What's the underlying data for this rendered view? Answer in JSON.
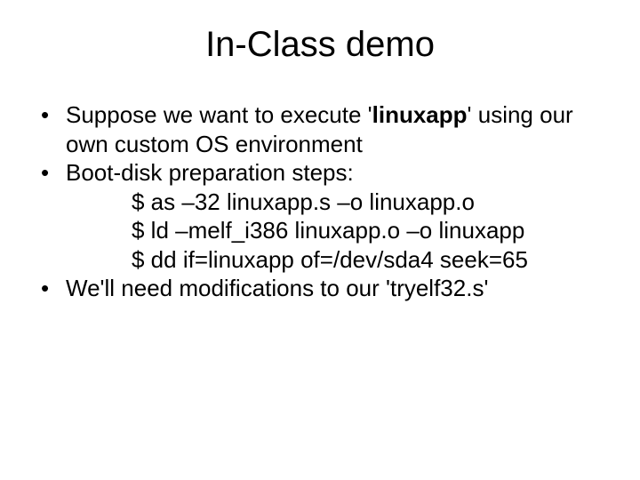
{
  "title": "In-Class demo",
  "bullets": {
    "b1_pre": "Suppose we want to execute '",
    "b1_bold": "linuxapp",
    "b1_post": "' using our own custom OS environment",
    "b2": "Boot-disk preparation steps:",
    "cmds": {
      "c1": "$ as –32 linuxapp.s –o linuxapp.o",
      "c2": "$ ld –melf_i386 linuxapp.o –o linuxapp",
      "c3": "$ dd if=linuxapp of=/dev/sda4 seek=65"
    },
    "b3": "We'll need modifications to our 'tryelf32.s'"
  }
}
